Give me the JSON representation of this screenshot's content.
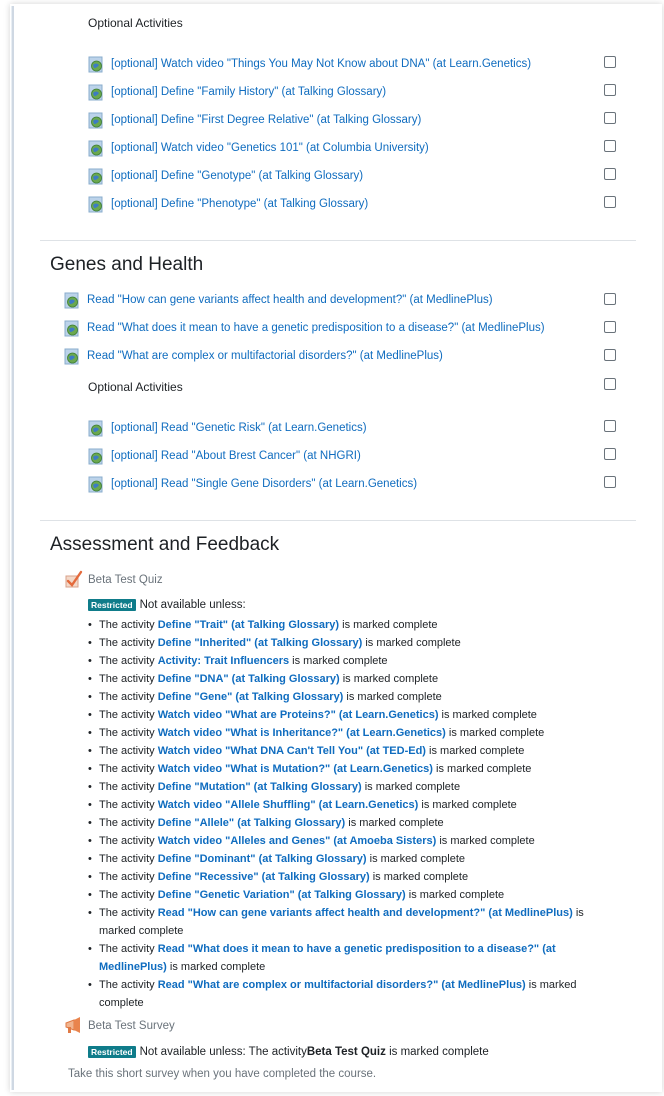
{
  "top": {
    "optional_heading": "Optional Activities",
    "items": [
      "[optional] Watch video \"Things You May Not Know about DNA\" (at Learn.Genetics)",
      "[optional] Define \"Family History\" (at Talking Glossary)",
      "[optional] Define \"First Degree Relative\" (at Talking Glossary)",
      "[optional] Watch video \"Genetics 101\" (at Columbia University)",
      "[optional] Define \"Genotype\" (at Talking Glossary)",
      "[optional] Define \"Phenotype\" (at Talking Glossary)"
    ]
  },
  "genes": {
    "title": "Genes and Health",
    "items": [
      "Read \"How can gene variants affect health and development?\" (at MedlinePlus)",
      "Read \"What does it mean to have a genetic predisposition to a disease?\" (at MedlinePlus)",
      "Read \"What are complex or multifactorial disorders?\" (at MedlinePlus)"
    ],
    "optional_heading": "Optional Activities",
    "optional_items": [
      "[optional] Read \"Genetic Risk\" (at Learn.Genetics)",
      "[optional] Read \"About Brest Cancer\" (at NHGRI)",
      "[optional] Read \"Single Gene Disorders\" (at Learn.Genetics)"
    ]
  },
  "assessment": {
    "title": "Assessment and Feedback",
    "quiz_label": "Beta Test Quiz",
    "restricted_badge": "Restricted",
    "not_available": "Not available unless:",
    "conditions": [
      {
        "pre": "The activity ",
        "name": "Define \"Trait\" (at Talking Glossary)",
        "post": " is marked complete"
      },
      {
        "pre": "The activity ",
        "name": "Define \"Inherited\" (at Talking Glossary)",
        "post": " is marked complete"
      },
      {
        "pre": "The activity ",
        "name": "Activity: Trait Influencers",
        "post": " is marked complete"
      },
      {
        "pre": "The activity ",
        "name": "Define \"DNA\" (at Talking Glossary)",
        "post": " is marked complete"
      },
      {
        "pre": "The activity ",
        "name": "Define \"Gene\" (at Talking Glossary)",
        "post": " is marked complete"
      },
      {
        "pre": "The activity ",
        "name": "Watch video \"What are Proteins?\" (at Learn.Genetics)",
        "post": " is marked complete"
      },
      {
        "pre": "The activity ",
        "name": "Watch video \"What is Inheritance?\" (at Learn.Genetics)",
        "post": " is marked complete"
      },
      {
        "pre": "The activity ",
        "name": "Watch video \"What DNA Can't Tell You\" (at TED-Ed)",
        "post": " is marked complete"
      },
      {
        "pre": "The activity ",
        "name": "Watch video \"What is Mutation?\" (at Learn.Genetics)",
        "post": " is marked complete"
      },
      {
        "pre": "The activity ",
        "name": "Define \"Mutation\" (at Talking Glossary)",
        "post": " is marked complete"
      },
      {
        "pre": "The activity ",
        "name": "Watch video \"Allele Shuffling\" (at Learn.Genetics)",
        "post": " is marked complete"
      },
      {
        "pre": "The activity ",
        "name": "Define \"Allele\" (at Talking Glossary)",
        "post": " is marked complete"
      },
      {
        "pre": "The activity ",
        "name": "Watch video \"Alleles and Genes\" (at Amoeba Sisters)",
        "post": " is marked complete"
      },
      {
        "pre": "The activity ",
        "name": "Define \"Dominant\" (at Talking Glossary)",
        "post": " is marked complete"
      },
      {
        "pre": "The activity ",
        "name": "Define \"Recessive\" (at Talking Glossary)",
        "post": " is marked complete"
      },
      {
        "pre": "The activity ",
        "name": "Define \"Genetic Variation\" (at Talking Glossary)",
        "post": " is marked complete"
      },
      {
        "pre": "The activity ",
        "name": "Read \"How can gene variants affect health and development?\" (at MedlinePlus)",
        "post": " is marked complete"
      },
      {
        "pre": "The activity ",
        "name": "Read \"What does it mean to have a genetic predisposition to a disease?\" (at MedlinePlus)",
        "post": " is marked complete"
      },
      {
        "pre": "The activity ",
        "name": "Read \"What are complex or multifactorial disorders?\" (at MedlinePlus)",
        "post": " is marked complete"
      }
    ],
    "survey_label": "Beta Test Survey",
    "survey_restricted_pre": "Not available unless: The activity ",
    "survey_restricted_name": "Beta Test Quiz",
    "survey_restricted_post": " is marked complete",
    "survey_note": "Take this short survey when you have completed the course."
  },
  "colors": {
    "link": "#0f6cbf",
    "badge": "#0f7c8a",
    "text": "#1d2125",
    "muted": "#6a737b"
  }
}
